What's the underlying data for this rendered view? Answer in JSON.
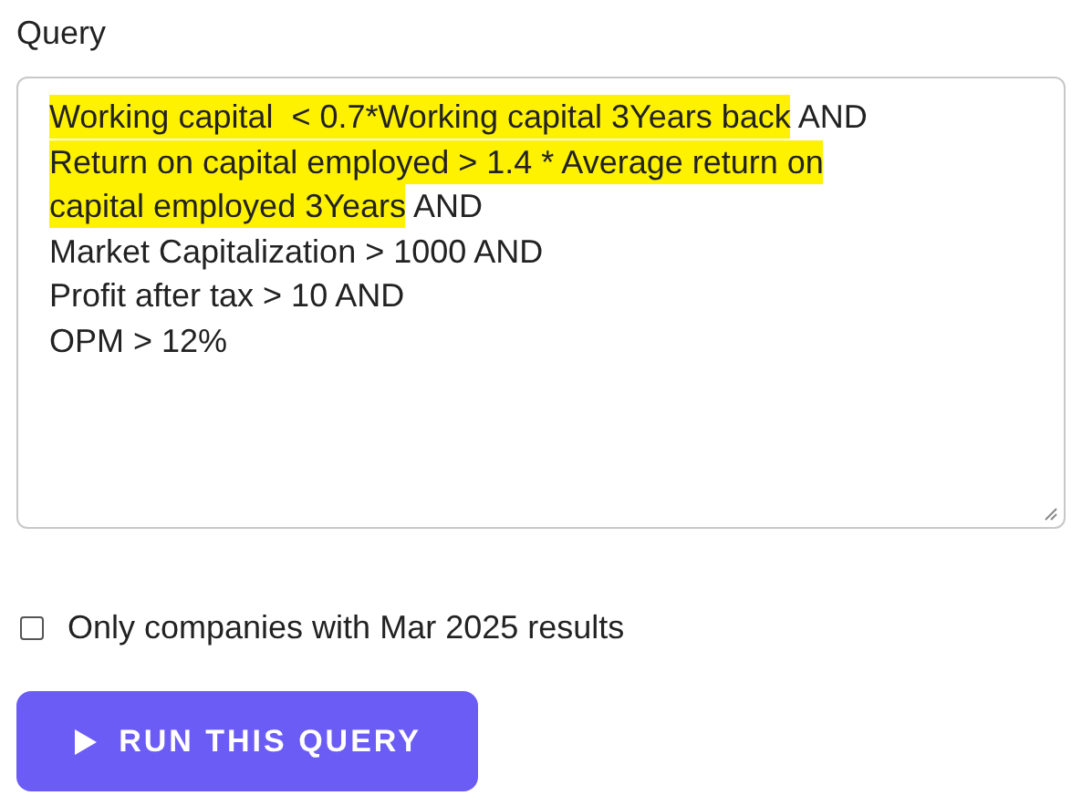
{
  "query": {
    "label": "Query",
    "lines": [
      [
        {
          "text": "Working capital  < 0.7*Working capital 3Years back",
          "highlighted": true
        },
        {
          "text": " AND",
          "highlighted": false
        }
      ],
      [
        {
          "text": "Return on capital employed > 1.4 * Average return on",
          "highlighted": true
        }
      ],
      [
        {
          "text": "capital employed 3Years",
          "highlighted": true
        },
        {
          "text": " AND",
          "highlighted": false
        }
      ],
      [
        {
          "text": "Market Capitalization > 1000 AND",
          "highlighted": false
        }
      ],
      [
        {
          "text": "Profit after tax > 10 AND",
          "highlighted": false
        }
      ],
      [
        {
          "text": "OPM > 12%",
          "highlighted": false
        }
      ]
    ]
  },
  "latest_results_option": {
    "label": "Only companies with Mar 2025 results",
    "checked": false
  },
  "run_button": {
    "label": "RUN THIS QUERY"
  }
}
